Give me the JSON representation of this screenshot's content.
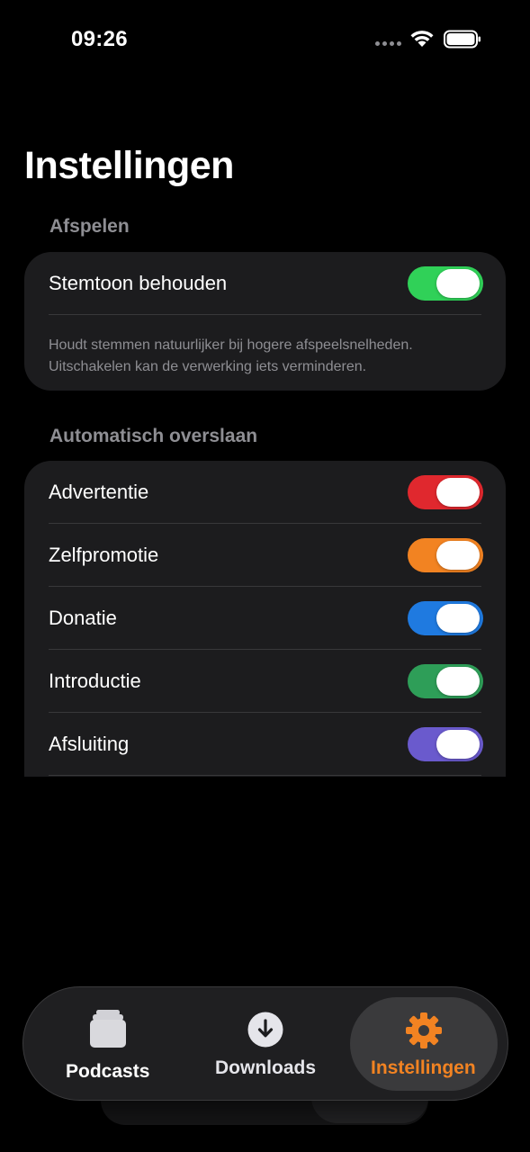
{
  "status_bar": {
    "time": "09:26"
  },
  "page": {
    "title": "Instellingen"
  },
  "sections": {
    "playback": {
      "header": "Afspelen",
      "rows": [
        {
          "label": "Stemtoon behouden",
          "on": true,
          "color": "#30d158"
        }
      ],
      "footnote_line1": "Houdt stemmen natuurlijker bij hogere afspeelsnelheden.",
      "footnote_line2": "Uitschakelen kan de verwerking iets verminderen."
    },
    "auto_skip": {
      "header": "Automatisch overslaan",
      "rows": [
        {
          "label": "Advertentie",
          "on": true,
          "color": "#e0282e"
        },
        {
          "label": "Zelfpromotie",
          "on": true,
          "color": "#f28322"
        },
        {
          "label": "Donatie",
          "on": true,
          "color": "#1f7ae0"
        },
        {
          "label": "Introductie",
          "on": true,
          "color": "#2e9e58"
        },
        {
          "label": "Afsluiting",
          "on": true,
          "color": "#6a5acd"
        }
      ]
    }
  },
  "tab_bar": {
    "tabs": [
      {
        "label": "Podcasts",
        "icon": "stack-icon",
        "active": false
      },
      {
        "label": "Downloads",
        "icon": "download-circle-icon",
        "active": false
      },
      {
        "label": "Instellingen",
        "icon": "gear-icon",
        "active": true
      }
    ],
    "accent": "#f28322"
  }
}
